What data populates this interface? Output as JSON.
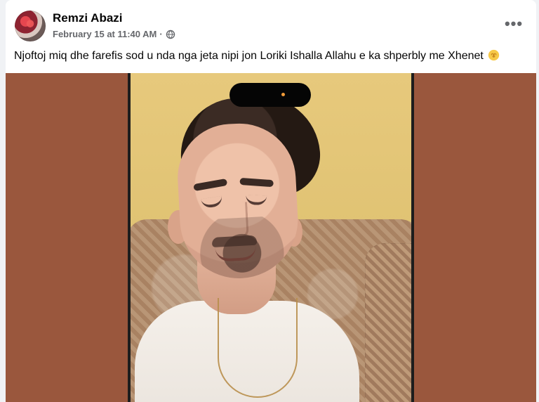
{
  "post": {
    "author_name": "Remzi Abazi",
    "timestamp": "February 15 at 11:40 AM",
    "separator": "·",
    "audience_icon": "globe-icon",
    "text": "Njoftoj miq dhe farefis sod u nda nga jeta nipi jon Loriki Ishalla Allahu e ka shperbly me Xhenet",
    "emoji_icon": "hands-emoji-icon",
    "menu_label": "•••"
  },
  "colors": {
    "page_background": "#f0f2f5",
    "card_background": "#ffffff",
    "meta_text": "#65676b",
    "media_background": "#9a573d"
  },
  "icons": {
    "avatar": "profile-avatar",
    "globe": "globe-icon",
    "menu": "more-options-icon",
    "emoji": "hands-emoji-icon"
  }
}
